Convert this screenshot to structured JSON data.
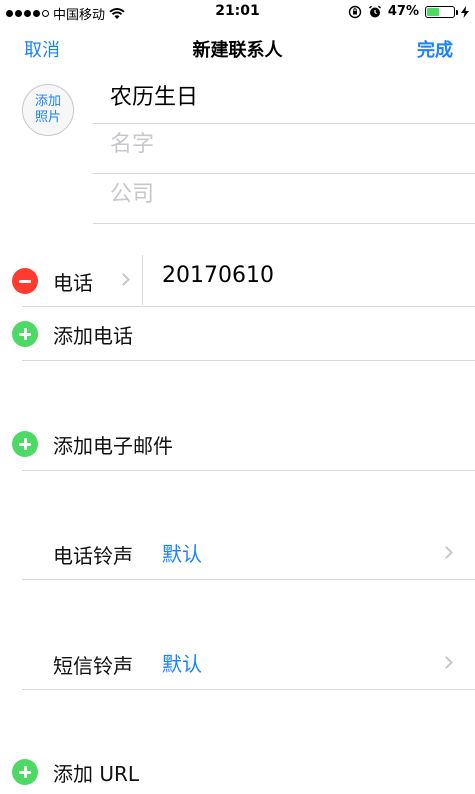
{
  "status": {
    "carrier": "中国移动",
    "time": "21:01",
    "battery": "47%",
    "battery_level": 0.47
  },
  "nav": {
    "cancel": "取消",
    "title": "新建联系人",
    "done": "完成"
  },
  "photo": {
    "line1": "添加",
    "line2": "照片"
  },
  "fields": {
    "first_name_value": "农历生日",
    "last_name_placeholder": "名字",
    "company_placeholder": "公司"
  },
  "phone": {
    "label": "电话",
    "value": "20170610"
  },
  "actions": {
    "add_phone": "添加电话",
    "add_email": "添加电子邮件",
    "add_url": "添加 URL"
  },
  "ringtone": {
    "label": "电话铃声",
    "value": "默认"
  },
  "texttone": {
    "label": "短信铃声",
    "value": "默认"
  },
  "colors": {
    "accent": "#1a82fb",
    "add": "#4cd964",
    "delete": "#ff3b30"
  }
}
